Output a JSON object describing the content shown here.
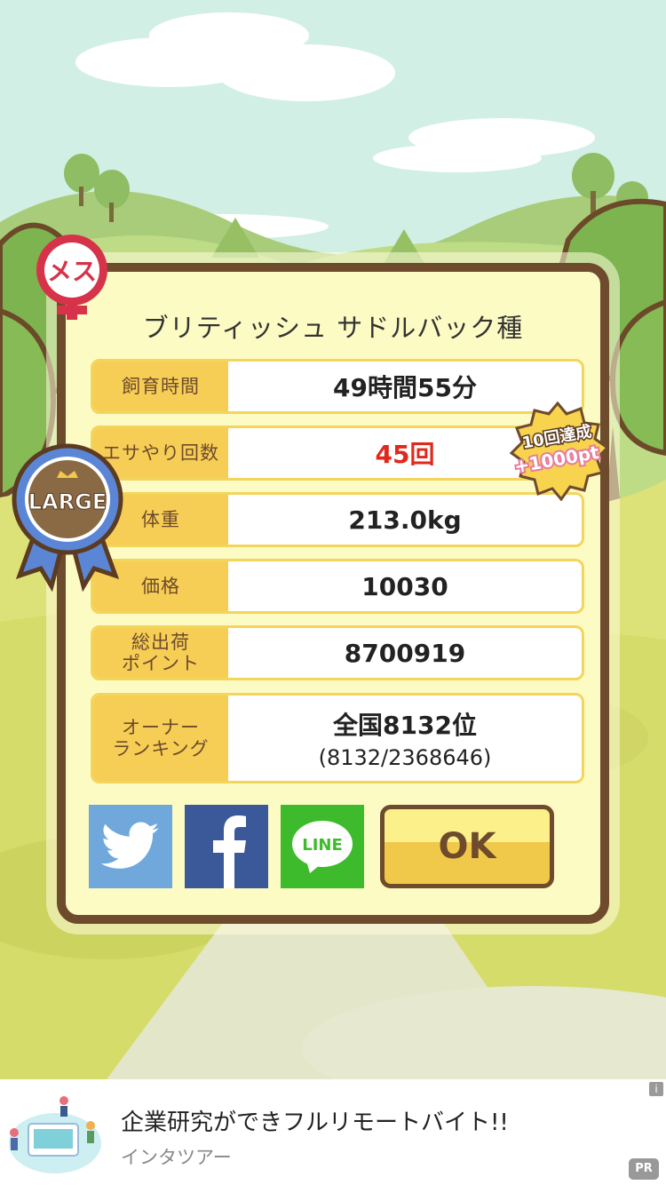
{
  "breed_title": "ブリティッシュ サドルバック種",
  "stats": [
    {
      "label": "飼育時間",
      "value": "49時間55分"
    },
    {
      "label": "エサやり回数",
      "value": "45回"
    },
    {
      "label": "体重",
      "value": "213.0kg"
    },
    {
      "label": "価格",
      "value": "10030"
    },
    {
      "label": "総出荷\nポイント",
      "value": "8700919"
    },
    {
      "label": "オーナー\nランキング",
      "value": "全国8132位",
      "sub": "(8132/2368646)"
    }
  ],
  "badges": {
    "gender": "メス",
    "size": "LARGE",
    "bonus_line1": "10回達成",
    "bonus_line2": "+1000pt"
  },
  "share": {
    "twitter_icon": "twitter-bird-icon",
    "facebook_icon": "facebook-f-icon",
    "line_label": "LINE"
  },
  "ok_label": "OK",
  "ad": {
    "title": "企業研究ができフルリモートバイト!!",
    "sponsor": "インタツアー",
    "info_label": "i",
    "pr_label": "PR"
  },
  "colors": {
    "frame_brown": "#6e4b2c",
    "label_yellow": "#f6ce56",
    "highlight_red": "#e0281d",
    "twitter": "#70a8dc",
    "facebook": "#3b5998",
    "line": "#3dbb2c",
    "female_red": "#d6334a",
    "ribbon_blue": "#5b86d6"
  }
}
